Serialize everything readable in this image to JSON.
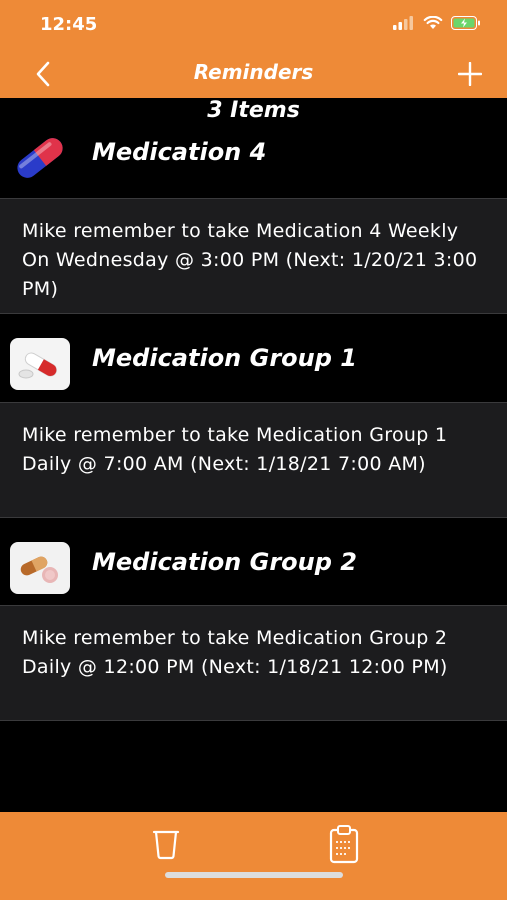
{
  "status_bar": {
    "time": "12:45"
  },
  "nav": {
    "title": "Reminders"
  },
  "list": {
    "count_label": "3 Items",
    "sections": [
      {
        "title": "Medication 4",
        "icon": "capsule-icon",
        "text": "Mike remember to take Medication 4 Weekly On Wednesday  @ 3:00 PM (Next: 1/20/21 3:00 PM)"
      },
      {
        "title": "Medication Group 1",
        "icon": "pills-icon",
        "text": "Mike remember to take Medication Group 1 Daily @ 7:00 AM (Next: 1/18/21 7:00 AM)"
      },
      {
        "title": "Medication Group 2",
        "icon": "pills-icon",
        "text": "Mike remember to take Medication Group 2 Daily @ 12:00 PM (Next: 1/18/21 12:00 PM)"
      }
    ]
  },
  "colors": {
    "accent": "#EE8A37",
    "background": "#000000",
    "row_background": "#1C1C1E"
  }
}
